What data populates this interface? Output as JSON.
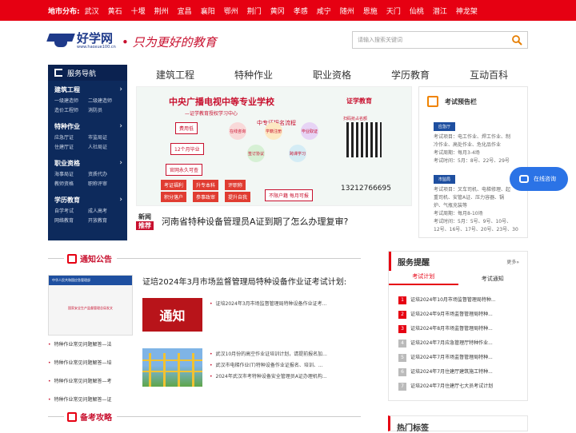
{
  "topbar": {
    "label": "地市分布:",
    "cities": [
      "武汉",
      "黄石",
      "十堰",
      "荆州",
      "宜昌",
      "襄阳",
      "鄂州",
      "荆门",
      "黄冈",
      "孝感",
      "咸宁",
      "随州",
      "恩施",
      "天门",
      "仙桃",
      "潜江",
      "神龙架"
    ]
  },
  "header": {
    "logo_name": "好学网",
    "logo_url": "www.haoxue100.cn",
    "slogan": "只为更好的教育",
    "search_placeholder": "请输入搜索关键词"
  },
  "sidenav": {
    "title": "服务导航",
    "categories": [
      {
        "title": "建筑工程",
        "items": [
          "一级建造师",
          "二级建造师",
          "造价工程师",
          "消防员"
        ]
      },
      {
        "title": "特种作业",
        "items": [
          "应急厅证",
          "市监局证",
          "住建厅证",
          "人社局证"
        ]
      },
      {
        "title": "职业资格",
        "items": [
          "海事局证",
          "资质代办",
          "教师资格",
          "职称评审"
        ]
      },
      {
        "title": "学历教育",
        "items": [
          "自学考试",
          "成人高考",
          "网络教育",
          "开放教育"
        ]
      }
    ]
  },
  "mainnav": [
    "建筑工程",
    "特种作业",
    "职业资格",
    "学历教育",
    "互动百科"
  ],
  "banner": {
    "title": "中央广播电视中等专业学校",
    "subtitle": "—证学教育授权学习中心",
    "flow_title": "中专证报名流程",
    "pills": [
      "费用低",
      "12个月毕业",
      "官网永久可查"
    ],
    "circles": [
      "在线咨询",
      "学籍注册",
      "毕业取证",
      "签订协议",
      "跨课学习"
    ],
    "tags": [
      "考证福利",
      "升专本科",
      "评职称",
      "积分落户",
      "参事政审",
      "提升自我"
    ],
    "tags_bottom": "不限户籍 每月可报",
    "brand": "证学教育",
    "scan": "扫码抢占名额",
    "phone": "13212766695"
  },
  "headline": {
    "badge_top": "新闻",
    "badge_bottom": "推荐",
    "text": "河南省特种设备管理员A证到期了怎么办理复审?"
  },
  "exam_panel": {
    "title": "考试预告栏",
    "blocks": [
      {
        "tag": "应急厅",
        "lines": [
          "考试项目：电工作业、焊工作业、制",
          "冷作业、高处作业、危化品作业",
          "考试周期：每月3-4场",
          "考试时间：5月：8号、22号、29号"
        ]
      },
      {
        "tag": "市监局",
        "lines": [
          "考试项目：叉车司机、电梯修理、起",
          "重司机、安管A证、压力容器、锅",
          "炉、气瓶充装等",
          "考试周期：每月8-10场",
          "考试时间：5月：5号、9号、10号、",
          "12号、16号、17号、20号、23号、30"
        ]
      }
    ]
  },
  "chat": {
    "label": "在线咨询"
  },
  "notice": {
    "section_title": "通知公告",
    "image_header": "中华人民共和国应急管理部",
    "image_caption": "国家安全生产监督管理总局发文",
    "left_list": [
      "特种作业常见问题解答—法",
      "特种作业常见问题解答—培",
      "特种作业常见问题解答—考",
      "特种作业常见问题解答—证"
    ],
    "center_title": "证培2024年3月市场监督管理局特种设备作业证考试计划:",
    "tongzhi": "通知",
    "list1": [
      "证培2024年3月市场监督管理局特种设备作业证考..."
    ],
    "list2": [
      "武汉10月份的高空作业证培训计划，请提前报名加...",
      "武汉市电梯作业(T)特种设备作业证报名、培训、...",
      "2024年武汉市考特种设备安全管理员A证办理机构..."
    ]
  },
  "service": {
    "title": "服务提醒",
    "more": "更多»",
    "tabs": [
      "考试计划",
      "考试通知"
    ],
    "items": [
      {
        "num": "1",
        "text": "证培2024年10月市场监督管理局特种..."
      },
      {
        "num": "2",
        "text": "证培2024年9月市场监督管理局特种..."
      },
      {
        "num": "3",
        "text": "证培2024年8月市场监督管理局特种..."
      },
      {
        "num": "4",
        "text": "证培2024年7月应急管理厅特种作业..."
      },
      {
        "num": "5",
        "text": "证培2024年7月市场监督管理局特种..."
      },
      {
        "num": "6",
        "text": "证培2024年7月住建厅建筑施工特种..."
      },
      {
        "num": "7",
        "text": "证培2024年7月住建厅七大员考试计划"
      }
    ]
  },
  "guide": {
    "section_title": "备考攻略"
  },
  "hot": {
    "title": "热门标签"
  }
}
